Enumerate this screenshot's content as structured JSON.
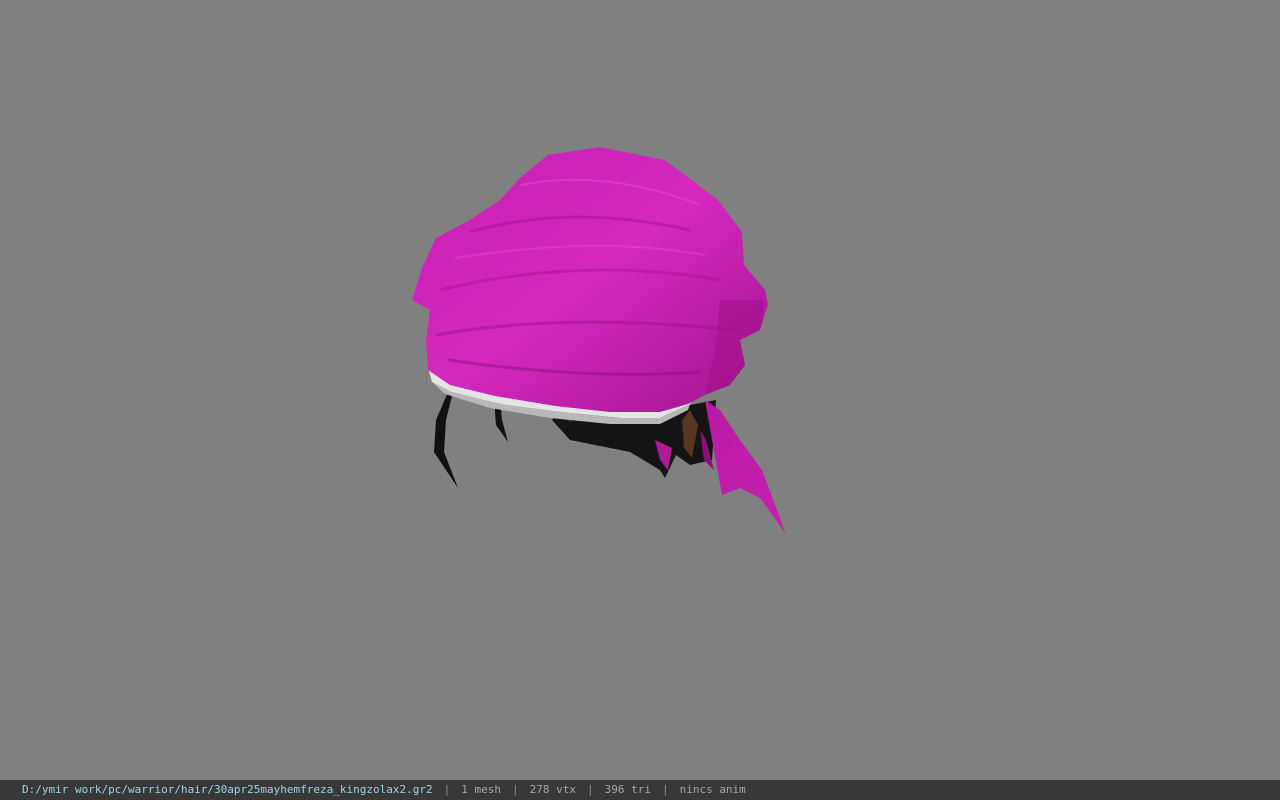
{
  "viewer": {
    "background_color": "#808080",
    "model": {
      "description_icon": "bandana-hair-model",
      "primary_color": "#cc22b8",
      "trim_color": "#e8e8e8",
      "hair_color": "#111111"
    }
  },
  "statusbar": {
    "file_path": "D:/ymir work/pc/warrior/hair/30apr25mayhemfreza_kingzolax2.gr2",
    "separator": "|",
    "mesh_count": "1 mesh",
    "vertex_count": "278 vtx",
    "triangle_count": "396 tri",
    "anim_info": "nincs anim"
  }
}
